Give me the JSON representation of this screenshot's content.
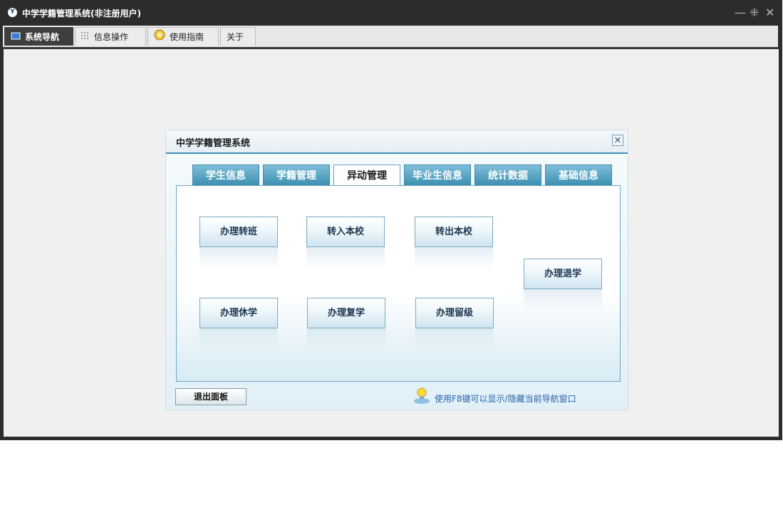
{
  "window": {
    "title": "中学学籍管理系统(非注册用户)",
    "app_icon_glyph": "Y",
    "controls": {
      "minimize": "—",
      "restore": "⁜",
      "close": "✕"
    }
  },
  "main_tabs": [
    {
      "label": "系统导航",
      "icon": "monitor-icon",
      "active": true
    },
    {
      "label": "信息操作",
      "icon": "grid-icon",
      "active": false
    },
    {
      "label": "使用指南",
      "icon": "help-circle-icon",
      "active": false
    },
    {
      "label": "关于",
      "icon": null,
      "active": false
    }
  ],
  "dialog": {
    "title": "中学学籍管理系统",
    "close": "✕",
    "tabs": [
      {
        "label": "学生信息",
        "active": false
      },
      {
        "label": "学籍管理",
        "active": false
      },
      {
        "label": "异动管理",
        "active": true
      },
      {
        "label": "毕业生信息",
        "active": false
      },
      {
        "label": "统计数据",
        "active": false
      },
      {
        "label": "基础信息",
        "active": false
      }
    ],
    "actions": [
      "办理转班",
      "转入本校",
      "转出本校",
      "办理退学",
      "办理休学",
      "办理复学",
      "办理留级"
    ],
    "exit_label": "退出面板",
    "hint": "使用F8键可以显示/隐藏当前导航窗口",
    "hint_icon": "lightbulb-icon"
  },
  "colors": {
    "titlebar": "#2c2c2c",
    "tab_active": "#3e3e3e",
    "dialog_accent": "#3f8fb8",
    "hint_text": "#2a63a8"
  }
}
